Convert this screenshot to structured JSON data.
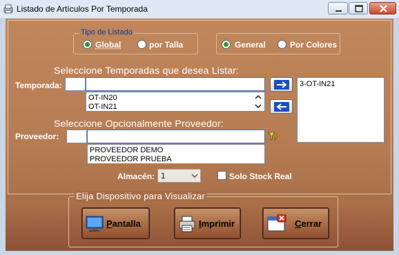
{
  "window": {
    "title": "Listado de Artículos Por Temporada",
    "minimize": "minimize",
    "maximize": "maximize",
    "close": "close"
  },
  "tipo_listado": {
    "legend": "Tipo de Listado",
    "options": [
      {
        "label": "Global",
        "selected": true
      },
      {
        "label": "por Talla",
        "selected": false
      }
    ]
  },
  "modo": {
    "options": [
      {
        "label": "General",
        "selected": true
      },
      {
        "label": "Por Colores",
        "selected": false
      }
    ]
  },
  "temporadas": {
    "heading": "Seleccione Temporadas que desea Listar:",
    "label": "Temporada:",
    "code_value": "",
    "search_value": "",
    "list": [
      "OT-IN20",
      "OT-IN21"
    ],
    "selected": [
      "3-OT-IN21"
    ],
    "add_icon": "arrow-right-icon",
    "remove_icon": "arrow-left-icon"
  },
  "proveedor": {
    "heading": "Seleccione Opcionalmente Proveedor:",
    "label": "Proveedor:",
    "code_value": "",
    "search_value": "",
    "list": [
      "PROVEEDOR DEMO",
      "PROVEEDOR PRUEBA"
    ],
    "filter_icon": "filter-lightning-icon"
  },
  "almacen": {
    "label": "Almacén:",
    "value": "1"
  },
  "solo_stock": {
    "label": "Solo Stock Real",
    "checked": false
  },
  "dispositivo": {
    "heading": "Elija Dispositivo para Visualizar",
    "buttons": [
      {
        "label_first": "P",
        "label_rest": "antalla",
        "icon": "monitor-icon"
      },
      {
        "label_first": "I",
        "label_rest": "mprimir",
        "icon": "printer-icon"
      },
      {
        "label_first": "C",
        "label_rest": "errar",
        "icon": "close-window-icon"
      }
    ]
  },
  "colors": {
    "panel": "#b57c53",
    "legend": "#123a9a",
    "radio_on": "#2a9a2a"
  }
}
